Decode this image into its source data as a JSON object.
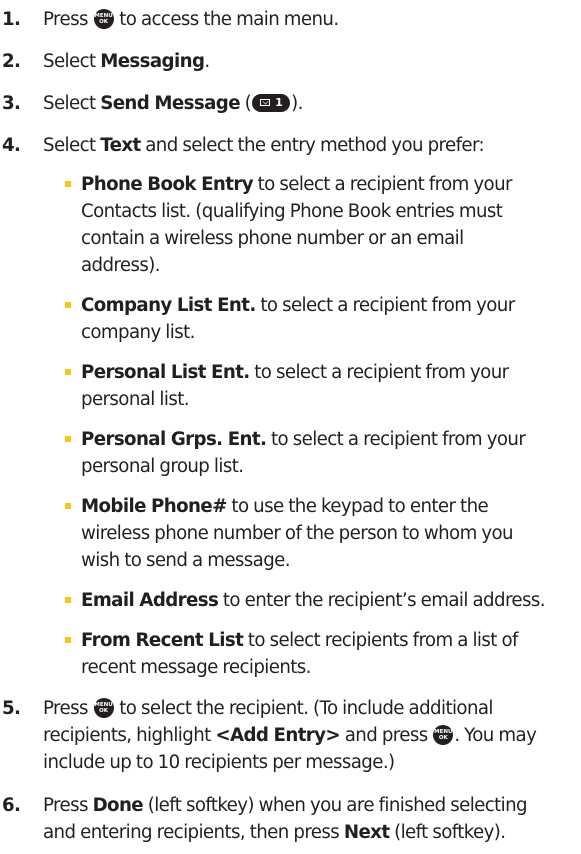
{
  "icons": {
    "menu_key": "menu-ok-key-icon",
    "message_key": "message-1-key-icon",
    "bullet": "square-bullet"
  },
  "menu_key": {
    "top": "MENU",
    "bottom": "OK"
  },
  "message_key": {
    "number": "1"
  },
  "colors": {
    "text": "#231f20",
    "bullet": "#f5c518"
  },
  "steps": [
    {
      "num": "1.",
      "pre": "Press ",
      "post": " to access the main menu."
    },
    {
      "num": "2.",
      "pre": "Select ",
      "bold": "Messaging",
      "post": "."
    },
    {
      "num": "3.",
      "pre": "Select ",
      "bold": "Send Message",
      "paren_open": " (",
      "paren_close": ")."
    },
    {
      "num": "4.",
      "pre": "Select ",
      "bold": "Text",
      "post": " and select the entry method you prefer:"
    },
    {
      "num": "5.",
      "l1_pre": "Press ",
      "l1_post": " to select the recipient. (To include additional",
      "l2_pre": "recipients, highlight ",
      "l2_bold": "<Add Entry>",
      "l2_mid": " and press ",
      "l2_post": ". You may",
      "l3": "include up to 10 recipients per message.)"
    },
    {
      "num": "6.",
      "l1_pre": "Press ",
      "l1_bold": "Done",
      "l1_post": " (left softkey) when you are finished selecting",
      "l2_pre": "and entering recipients, then press ",
      "l2_bold": "Next",
      "l2_post": " (left softkey)."
    }
  ],
  "options": [
    {
      "label": "Phone Book Entry",
      "lines": [
        " to select a recipient from your",
        "Contacts list. (qualifying Phone Book entries must",
        "contain a wireless phone number or an email",
        "address)."
      ]
    },
    {
      "label": "Company List Ent.",
      "lines": [
        " to select a recipient from your",
        "company list."
      ]
    },
    {
      "label": "Personal List Ent.",
      "lines": [
        " to select a recipient from your",
        "personal list."
      ]
    },
    {
      "label": "Personal Grps. Ent.",
      "lines": [
        " to select a recipient from your",
        "personal group list."
      ]
    },
    {
      "label": "Mobile Phone#",
      "lines": [
        " to use the keypad to enter the",
        "wireless phone number of the person to whom you",
        "wish to send a message."
      ]
    },
    {
      "label": "Email Address",
      "lines": [
        " to enter the recipient’s email address."
      ]
    },
    {
      "label": "From Recent List",
      "lines": [
        " to select recipients from a list of",
        "recent message recipients."
      ]
    }
  ]
}
